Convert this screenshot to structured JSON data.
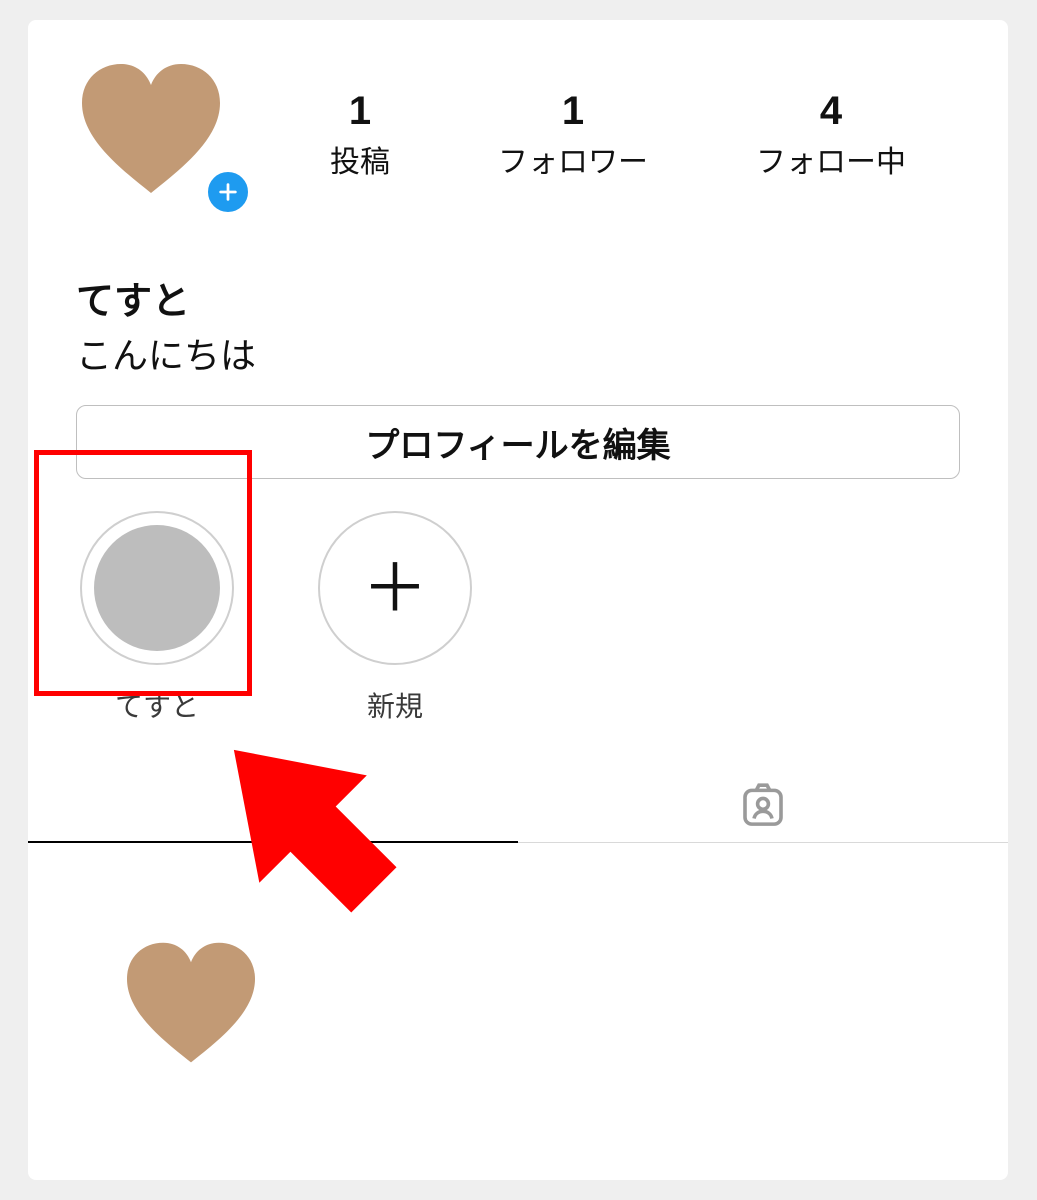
{
  "profile": {
    "stats": {
      "posts": {
        "value": "1",
        "label": "投稿"
      },
      "followers": {
        "value": "1",
        "label": "フォロワー"
      },
      "following": {
        "value": "4",
        "label": "フォロー中"
      }
    },
    "name": "てすと",
    "bio": "こんにちは",
    "edit_button": "プロフィールを編集"
  },
  "highlights": [
    {
      "label": "てすと"
    },
    {
      "label": "新規"
    }
  ],
  "colors": {
    "heart": "#c29a75",
    "accent_blue": "#1e9bf0",
    "annotation_red": "#ff0000"
  }
}
